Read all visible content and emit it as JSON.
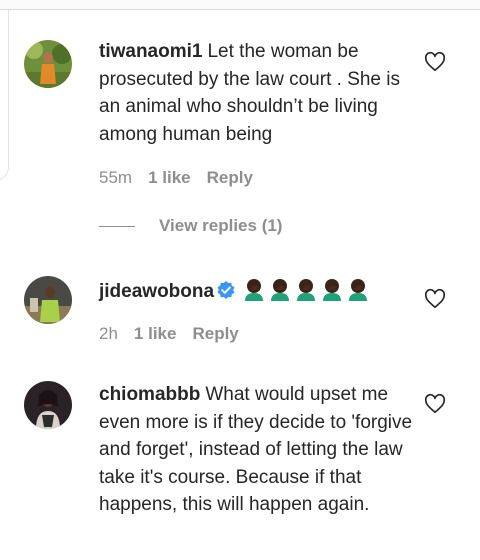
{
  "comments": [
    {
      "username": "tiwanaomi1",
      "text": "Let the woman be prosecuted by the law court . She is an animal who shouldn’t be living among human being",
      "time": "55m",
      "likes": "1 like",
      "reply_label": "Reply",
      "avatar_icon": "avatar-photo",
      "view_replies": "View replies (1)"
    },
    {
      "username": "jideawobona",
      "verified": true,
      "emoji_desc": "five person-facepalming emoji (dark skin tone)",
      "time": "2h",
      "likes": "1 like",
      "reply_label": "Reply",
      "avatar_icon": "avatar-photo"
    },
    {
      "username": "chiomabbb",
      "text": "What would upset me even more is if they decide to 'forgive and forget', instead of letting the law take it's course. Because if that happens, this will happen again.",
      "avatar_icon": "avatar-photo"
    }
  ],
  "colors": {
    "text": "#262626",
    "meta": "#8e8e8e",
    "verified": "#3897f0"
  }
}
